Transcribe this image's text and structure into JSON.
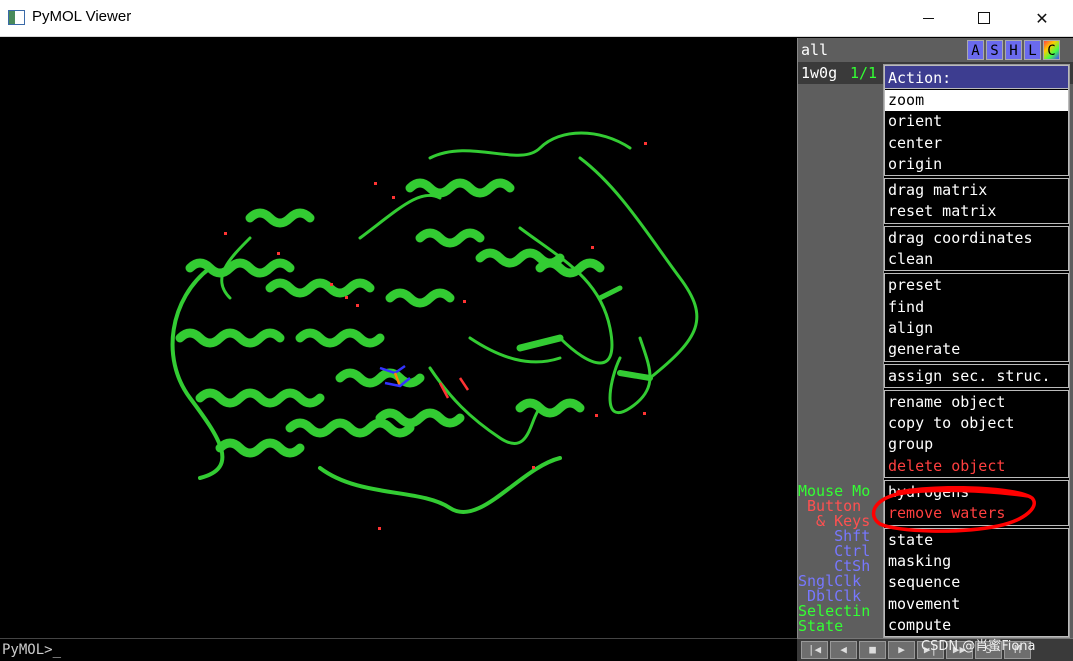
{
  "window": {
    "title": "PyMOL Viewer"
  },
  "objects": {
    "all": {
      "name": "all",
      "buttons": [
        "A",
        "S",
        "H",
        "L",
        "C"
      ]
    },
    "items": [
      {
        "name": "1w0g",
        "state": "1/1"
      }
    ]
  },
  "menu": {
    "header": "Action:",
    "groups": [
      [
        {
          "label": "zoom",
          "selected": true
        },
        {
          "label": "orient"
        },
        {
          "label": "center"
        },
        {
          "label": "origin"
        }
      ],
      [
        {
          "label": "drag matrix"
        },
        {
          "label": "reset matrix"
        }
      ],
      [
        {
          "label": "drag coordinates"
        },
        {
          "label": "clean"
        }
      ],
      [
        {
          "label": "preset"
        },
        {
          "label": "find"
        },
        {
          "label": "align"
        },
        {
          "label": "generate"
        }
      ],
      [
        {
          "label": "assign sec. struc."
        }
      ],
      [
        {
          "label": "rename object"
        },
        {
          "label": "copy to object"
        },
        {
          "label": "group"
        },
        {
          "label": "delete object",
          "danger": true
        }
      ],
      [
        {
          "label": "hydrogens"
        },
        {
          "label": "remove waters",
          "danger": true
        }
      ],
      [
        {
          "label": "state"
        },
        {
          "label": "masking"
        },
        {
          "label": "sequence"
        },
        {
          "label": "movement"
        },
        {
          "label": "compute"
        }
      ]
    ]
  },
  "hints": [
    {
      "text": "Mouse Mo",
      "color": "#33ff33"
    },
    {
      "text": " Button",
      "color": "#ff5050"
    },
    {
      "text": "  & Keys",
      "color": "#ff5050"
    },
    {
      "text": "    Shft",
      "color": "#7777ff"
    },
    {
      "text": "    Ctrl",
      "color": "#7777ff"
    },
    {
      "text": "    CtSh",
      "color": "#7777ff"
    },
    {
      "text": "SnglClk",
      "color": "#7777ff"
    },
    {
      "text": " DblClk",
      "color": "#7777ff"
    },
    {
      "text": "Selectin",
      "color": "#33ff33"
    },
    {
      "text": "State",
      "color": "#33ff33"
    }
  ],
  "command": {
    "prompt": "PyMOL>_"
  },
  "playback": {
    "buttons": [
      "|◀",
      "◀",
      "■",
      "▶",
      "▶|",
      "▶▶",
      "S",
      "M"
    ]
  },
  "watermark": "CSDN @肖蜜Fiona",
  "colors": {
    "ribbon": "#33cc33",
    "menu_header": "#3d3d90",
    "danger": "#ff3f3f",
    "annotation": "#ff0000"
  }
}
